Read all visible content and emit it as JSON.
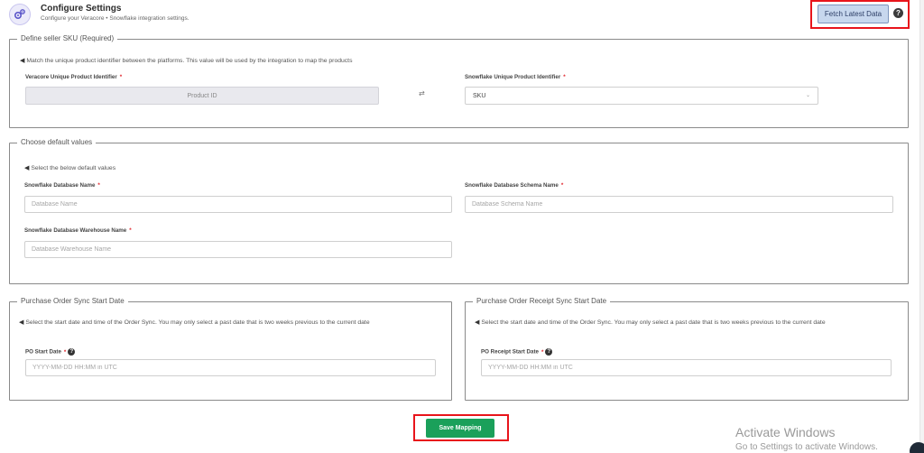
{
  "header": {
    "title": "Configure Settings",
    "subtitle": "Configure your Veracore • Snowflake integration settings.",
    "fetch_label": "Fetch Latest Data",
    "help_symbol": "?"
  },
  "sku_section": {
    "legend": "Define seller SKU (Required)",
    "hint": "Match the unique product identifier between the platforms. This value will be used by the integration to map the products",
    "left_label": "Veracore Unique Product Identifier",
    "left_value": "Product ID",
    "right_label": "Snowflake Unique Product Identifier",
    "right_value": "SKU",
    "required_mark": "*"
  },
  "defaults_section": {
    "legend": "Choose default values",
    "hint": "Select the below default values",
    "db_name_label": "Snowflake Database Name",
    "db_name_placeholder": "Database Name",
    "schema_label": "Snowflake Database Schema Name",
    "schema_placeholder": "Database Schema Name",
    "warehouse_label": "Snowflake Database Warehouse Name",
    "warehouse_placeholder": "Database Warehouse Name",
    "required_mark": "*"
  },
  "po_section": {
    "legend": "Purchase Order Sync Start Date",
    "hint": "Select the start date and time of the Order Sync. You may only select a past date that is two weeks previous to the current date",
    "label": "PO Start Date",
    "placeholder": "YYYY-MM-DD HH:MM in UTC",
    "required_mark": "*",
    "help_symbol": "?"
  },
  "po_receipt_section": {
    "legend": "Purchase Order Receipt Sync Start Date",
    "hint": "Select the start date and time of the Order Sync. You may only select a past date that is two weeks previous to the current date",
    "label": "PO Receipt Start Date",
    "placeholder": "YYYY-MM-DD HH:MM in UTC",
    "required_mark": "*",
    "help_symbol": "?"
  },
  "footer": {
    "save_label": "Save Mapping"
  },
  "watermark": {
    "line1": "Activate Windows",
    "line2": "Go to Settings to activate Windows."
  },
  "colors": {
    "save": "#1aa05a",
    "highlight": "#e8141b",
    "fetch_bg": "#c7d7ee"
  },
  "icons": {
    "logo": "gears-icon",
    "hint": "megaphone-icon",
    "swap": "swap-arrows-icon",
    "chevron": "chevron-down-icon"
  }
}
